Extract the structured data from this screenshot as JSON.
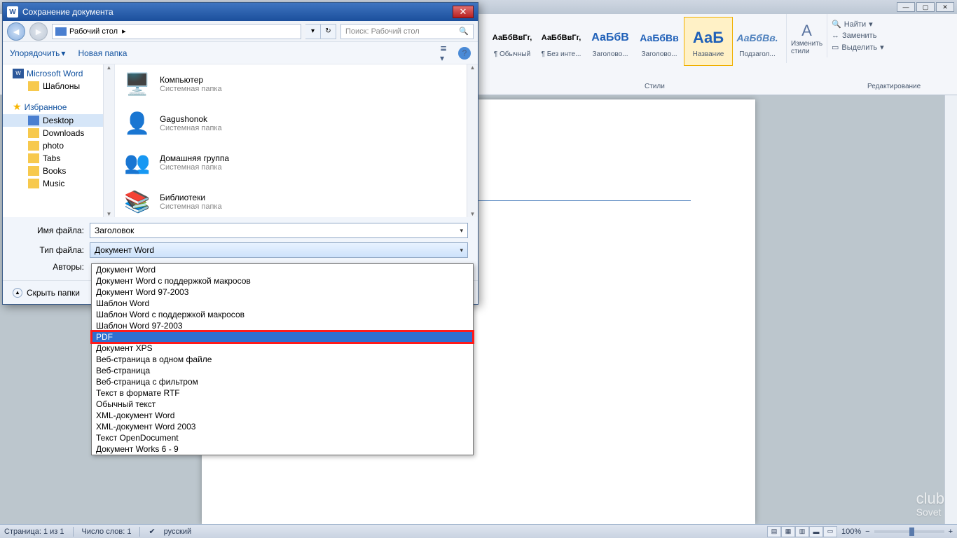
{
  "word": {
    "styles": [
      {
        "preview": "АаБбВвГг,",
        "label": "¶ Обычный",
        "cls": "style-prev-black",
        "size": "11px"
      },
      {
        "preview": "АаБбВвГг,",
        "label": "¶ Без инте...",
        "cls": "style-prev-black",
        "size": "11px"
      },
      {
        "preview": "АаБбВ",
        "label": "Заголово...",
        "cls": "style-prev-blue",
        "size": "16px"
      },
      {
        "preview": "АаБбВв",
        "label": "Заголово...",
        "cls": "style-prev-blue",
        "size": "14px"
      },
      {
        "preview": "АаБ",
        "label": "Название",
        "cls": "style-prev-blue",
        "size": "22px",
        "selected": true
      },
      {
        "preview": "АаБбВв.",
        "label": "Подзагол...",
        "cls": "style-prev-cyan",
        "size": "14px"
      }
    ],
    "styles_label": "Стили",
    "change_styles": "Изменить стили",
    "editing_label": "Редактирование",
    "find": "Найти",
    "replace": "Заменить",
    "select": "Выделить",
    "status_page": "Страница: 1 из 1",
    "status_words": "Число слов: 1",
    "status_lang": "русский",
    "zoom": "100%"
  },
  "dialog": {
    "title": "Сохранение документа",
    "breadcrumb": "Рабочий стол",
    "search_placeholder": "Поиск: Рабочий стол",
    "organize": "Упорядочить",
    "new_folder": "Новая папка",
    "tree": {
      "ms_word": "Microsoft Word",
      "templates": "Шаблоны",
      "favorites": "Избранное",
      "items": [
        "Desktop",
        "Downloads",
        "photo",
        "Tabs",
        "Books",
        "Music"
      ]
    },
    "files": [
      {
        "name": "Компьютер",
        "sub": "Системная папка",
        "icon": "🖥️"
      },
      {
        "name": "Gagushonok",
        "sub": "Системная папка",
        "icon": "👤"
      },
      {
        "name": "Домашняя группа",
        "sub": "Системная папка",
        "icon": "👥"
      },
      {
        "name": "Библиотеки",
        "sub": "Системная папка",
        "icon": "📚"
      }
    ],
    "filename_label": "Имя файла:",
    "filename_value": "Заголовок",
    "filetype_label": "Тип файла:",
    "filetype_value": "Документ Word",
    "authors_label": "Авторы:",
    "hide_folders": "Скрыть папки"
  },
  "filetypes": [
    "Документ Word",
    "Документ Word с поддержкой макросов",
    "Документ Word 97-2003",
    "Шаблон Word",
    "Шаблон Word с поддержкой макросов",
    "Шаблон Word 97-2003",
    "PDF",
    "Документ XPS",
    "Веб-страница в одном файле",
    "Веб-страница",
    "Веб-страница с фильтром",
    "Текст в формате RTF",
    "Обычный текст",
    "XML-документ Word",
    "XML-документ Word 2003",
    "Текст OpenDocument",
    "Документ Works 6 - 9"
  ],
  "watermark": {
    "top": "club",
    "bot": "Sovet"
  }
}
